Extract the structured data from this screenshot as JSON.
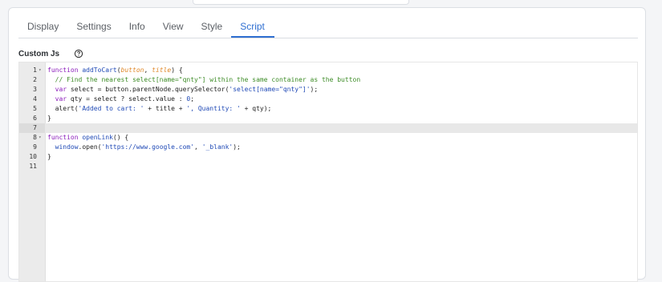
{
  "tabs": [
    {
      "label": "Display",
      "active": false
    },
    {
      "label": "Settings",
      "active": false
    },
    {
      "label": "Info",
      "active": false
    },
    {
      "label": "View",
      "active": false
    },
    {
      "label": "Style",
      "active": false
    },
    {
      "label": "Script",
      "active": true
    }
  ],
  "field": {
    "label": "Custom Js",
    "help_icon": "question-circle-icon"
  },
  "editor": {
    "current_line": 7,
    "lines": [
      {
        "num": "1",
        "fold": true,
        "tokens": [
          [
            "kw",
            "function "
          ],
          [
            "fn",
            "addToCart"
          ],
          [
            "p",
            "("
          ],
          [
            "param",
            "button"
          ],
          [
            "p",
            ", "
          ],
          [
            "param",
            "title"
          ],
          [
            "p",
            ") {"
          ]
        ]
      },
      {
        "num": "2",
        "fold": false,
        "tokens": [
          [
            "p",
            "  "
          ],
          [
            "cm",
            "// Find the nearest select[name=\"qnty\"] within the same container as the button"
          ]
        ]
      },
      {
        "num": "3",
        "fold": false,
        "tokens": [
          [
            "p",
            "  "
          ],
          [
            "kw",
            "var"
          ],
          [
            "p",
            " select = button.parentNode.querySelector("
          ],
          [
            "str",
            "'select[name=\"qnty\"]'"
          ],
          [
            "p",
            ");"
          ]
        ]
      },
      {
        "num": "4",
        "fold": false,
        "tokens": [
          [
            "p",
            "  "
          ],
          [
            "kw",
            "var"
          ],
          [
            "p",
            " qty = select ? select.value : "
          ],
          [
            "num",
            "0"
          ],
          [
            "p",
            ";"
          ]
        ]
      },
      {
        "num": "5",
        "fold": false,
        "tokens": [
          [
            "p",
            "  alert("
          ],
          [
            "str",
            "'Added to cart: '"
          ],
          [
            "p",
            " + title + "
          ],
          [
            "str",
            "', Quantity: '"
          ],
          [
            "p",
            " + qty);"
          ]
        ]
      },
      {
        "num": "6",
        "fold": false,
        "tokens": [
          [
            "p",
            "}"
          ]
        ]
      },
      {
        "num": "7",
        "fold": false,
        "tokens": []
      },
      {
        "num": "8",
        "fold": true,
        "tokens": [
          [
            "kw",
            "function "
          ],
          [
            "fn",
            "openLink"
          ],
          [
            "p",
            "() {"
          ]
        ]
      },
      {
        "num": "9",
        "fold": false,
        "tokens": [
          [
            "p",
            "  "
          ],
          [
            "win",
            "window"
          ],
          [
            "p",
            ".open("
          ],
          [
            "str",
            "'https://www.google.com'"
          ],
          [
            "p",
            ", "
          ],
          [
            "str",
            "'_blank'"
          ],
          [
            "p",
            ");"
          ]
        ]
      },
      {
        "num": "10",
        "fold": false,
        "tokens": [
          [
            "p",
            "}"
          ]
        ]
      },
      {
        "num": "11",
        "fold": false,
        "tokens": []
      }
    ]
  }
}
